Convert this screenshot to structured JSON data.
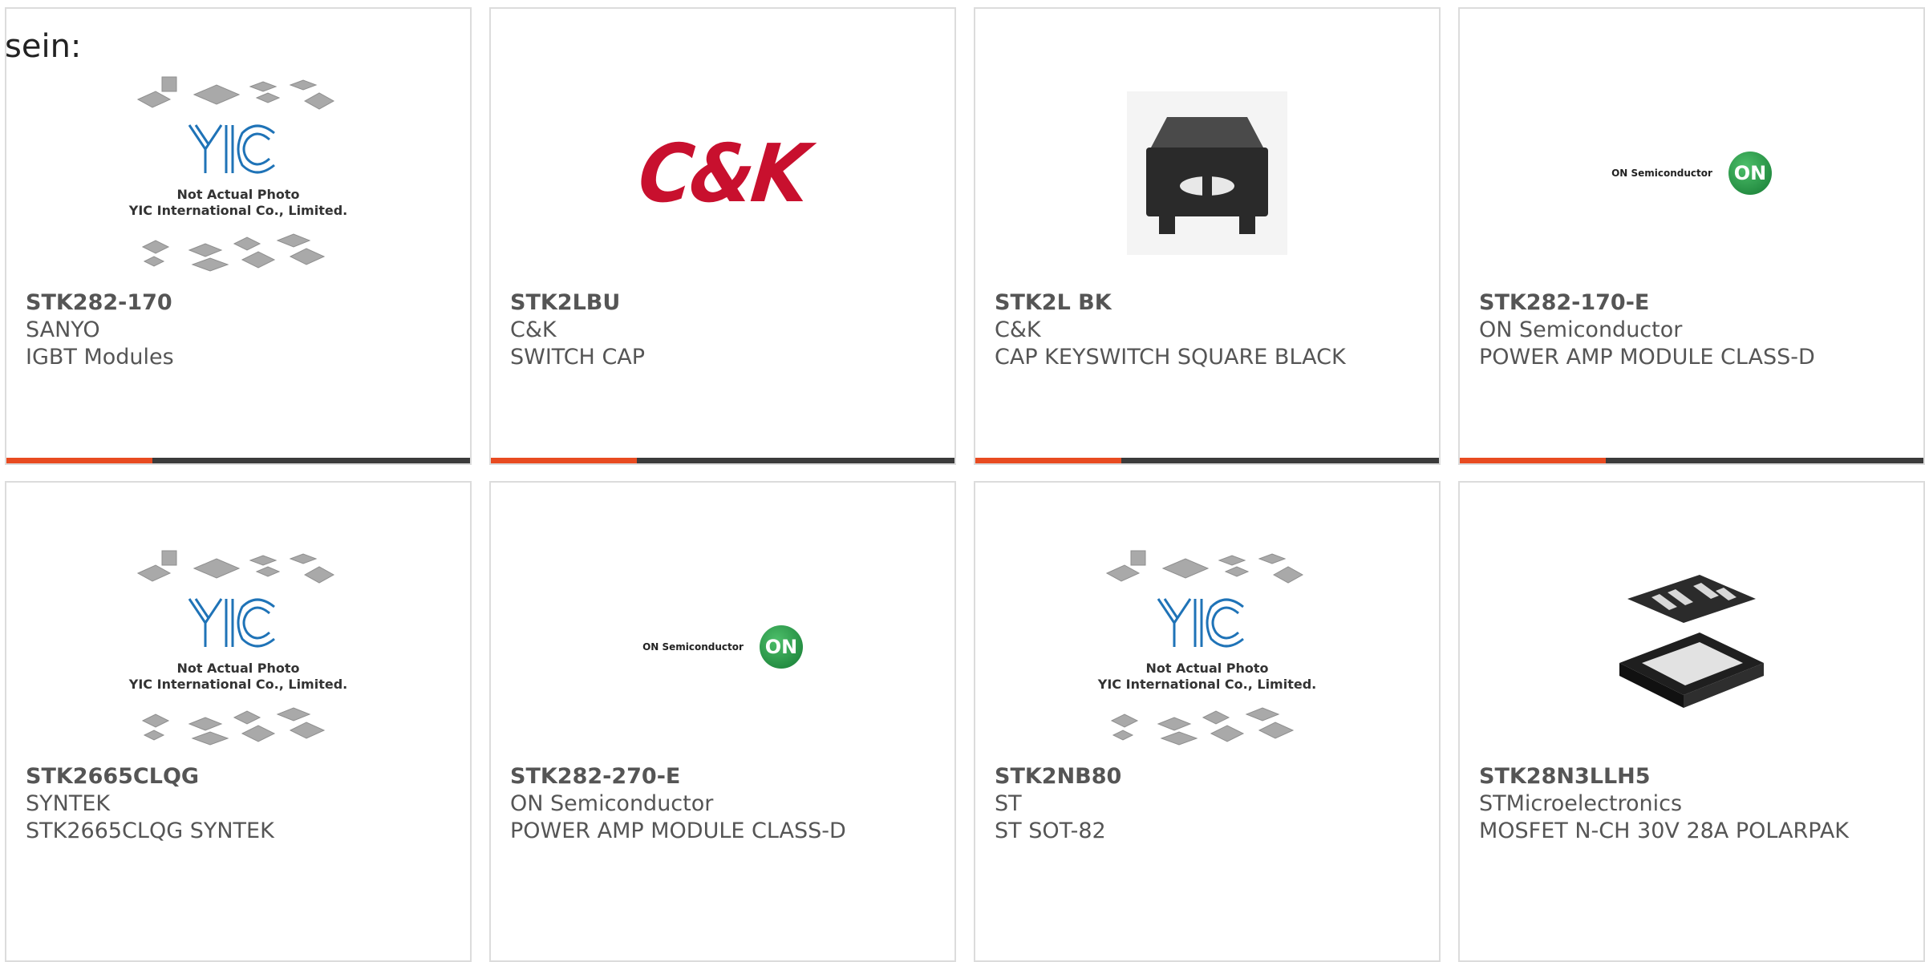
{
  "lead_text": "sein:",
  "theme": {
    "accent": "#e84b21",
    "bar": "#3b3b3b",
    "ck_red": "#c8102e",
    "on_green": "#1f9a46"
  },
  "products": [
    {
      "part_number": "STK282-170",
      "manufacturer": "SANYO",
      "description": "IGBT Modules",
      "image_icon": "yic-not-actual-photo-icon",
      "image_caption1": "Not Actual Photo",
      "image_caption2": "YIC International Co., Limited."
    },
    {
      "part_number": "STK2LBU",
      "manufacturer": "C&K",
      "description": "SWITCH CAP",
      "image_icon": "ck-logo-icon",
      "logo_text": "C&K"
    },
    {
      "part_number": "STK2L BK",
      "manufacturer": "C&K",
      "description": "CAP KEYSWITCH SQUARE BLACK",
      "image_icon": "black-keycap-photo-icon"
    },
    {
      "part_number": "STK282-170-E",
      "manufacturer": "ON Semiconductor",
      "description": "POWER AMP MODULE CLASS-D",
      "image_icon": "on-semiconductor-logo-icon",
      "logo_text": "ON Semiconductor",
      "logo_mark": "ON"
    },
    {
      "part_number": "STK2665CLQG",
      "manufacturer": "SYNTEK",
      "description": "STK2665CLQG SYNTEK",
      "image_icon": "yic-not-actual-photo-icon",
      "image_caption1": "Not Actual Photo",
      "image_caption2": "YIC International Co., Limited."
    },
    {
      "part_number": "STK282-270-E",
      "manufacturer": "ON Semiconductor",
      "description": "POWER AMP MODULE CLASS-D",
      "image_icon": "on-semiconductor-logo-icon",
      "logo_text": "ON Semiconductor",
      "logo_mark": "ON"
    },
    {
      "part_number": "STK2NB80",
      "manufacturer": "ST",
      "description": "ST SOT-82",
      "image_icon": "yic-not-actual-photo-icon",
      "image_caption1": "Not Actual Photo",
      "image_caption2": "YIC International Co., Limited."
    },
    {
      "part_number": "STK28N3LLH5",
      "manufacturer": "STMicroelectronics",
      "description": "MOSFET N-CH 30V 28A POLARPAK",
      "image_icon": "polarpak-chip-photo-icon"
    }
  ]
}
